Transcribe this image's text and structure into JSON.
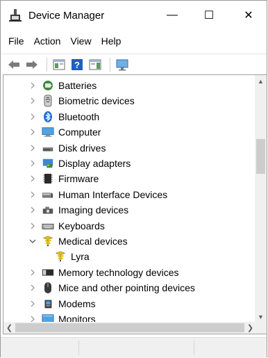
{
  "window": {
    "title": "Device Manager",
    "controls": {
      "minimize": "—",
      "maximize": "☐",
      "close": "✕"
    }
  },
  "menu": [
    "File",
    "Action",
    "View",
    "Help"
  ],
  "toolbar": [
    "back-icon",
    "forward-icon",
    "properties-icon",
    "help-icon",
    "action-pane-icon",
    "scan-monitor-icon"
  ],
  "tree": [
    {
      "label": "Batteries",
      "icon": "battery-icon",
      "state": "collapsed",
      "level": 0
    },
    {
      "label": "Biometric devices",
      "icon": "fingerprint-icon",
      "state": "collapsed",
      "level": 0
    },
    {
      "label": "Bluetooth",
      "icon": "bluetooth-icon",
      "state": "collapsed",
      "level": 0
    },
    {
      "label": "Computer",
      "icon": "computer-icon",
      "state": "collapsed",
      "level": 0
    },
    {
      "label": "Disk drives",
      "icon": "disk-drive-icon",
      "state": "collapsed",
      "level": 0
    },
    {
      "label": "Display adapters",
      "icon": "display-adapter-icon",
      "state": "collapsed",
      "level": 0
    },
    {
      "label": "Firmware",
      "icon": "firmware-icon",
      "state": "collapsed",
      "level": 0
    },
    {
      "label": "Human Interface Devices",
      "icon": "hid-icon",
      "state": "collapsed",
      "level": 0
    },
    {
      "label": "Imaging devices",
      "icon": "camera-icon",
      "state": "collapsed",
      "level": 0
    },
    {
      "label": "Keyboards",
      "icon": "keyboard-icon",
      "state": "collapsed",
      "level": 0
    },
    {
      "label": "Medical devices",
      "icon": "medical-icon",
      "state": "expanded",
      "level": 0
    },
    {
      "label": "Lyra",
      "icon": "medical-icon",
      "state": "leaf",
      "level": 1
    },
    {
      "label": "Memory technology devices",
      "icon": "memory-icon",
      "state": "collapsed",
      "level": 0
    },
    {
      "label": "Mice and other pointing devices",
      "icon": "mouse-icon",
      "state": "collapsed",
      "level": 0
    },
    {
      "label": "Modems",
      "icon": "modem-icon",
      "state": "collapsed",
      "level": 0
    },
    {
      "label": "Monitors",
      "icon": "monitor-icon",
      "state": "collapsed",
      "level": 0
    }
  ]
}
